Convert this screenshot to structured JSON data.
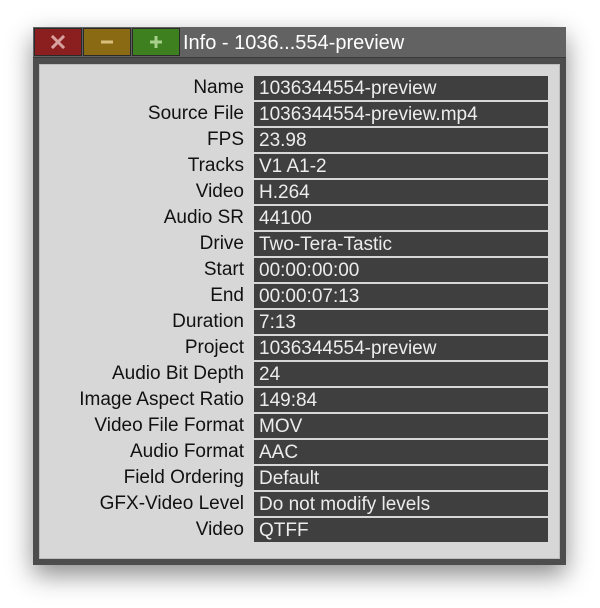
{
  "window": {
    "title": "Info - 1036...554-preview",
    "buttons": {
      "close_icon": "close-x-icon",
      "minimize_icon": "minus-icon",
      "maximize_icon": "plus-icon",
      "close_color": "#8b1e1e",
      "minimize_color": "#8b6a14",
      "maximize_color": "#3e7f20"
    }
  },
  "fields": [
    {
      "label": "Name",
      "value": "1036344554-preview"
    },
    {
      "label": "Source File",
      "value": "1036344554-preview.mp4"
    },
    {
      "label": "FPS",
      "value": "23.98"
    },
    {
      "label": "Tracks",
      "value": "V1 A1-2"
    },
    {
      "label": "Video",
      "value": "H.264"
    },
    {
      "label": "Audio SR",
      "value": "44100"
    },
    {
      "label": "Drive",
      "value": "Two-Tera-Tastic"
    },
    {
      "label": "Start",
      "value": "00:00:00:00"
    },
    {
      "label": "End",
      "value": "00:00:07:13"
    },
    {
      "label": "Duration",
      "value": "7:13"
    },
    {
      "label": "Project",
      "value": "1036344554-preview"
    },
    {
      "label": "Audio Bit Depth",
      "value": "24"
    },
    {
      "label": "Image Aspect Ratio",
      "value": "149:84"
    },
    {
      "label": "Video File Format",
      "value": "MOV"
    },
    {
      "label": "Audio Format",
      "value": "AAC"
    },
    {
      "label": "Field Ordering",
      "value": "Default"
    },
    {
      "label": "GFX-Video Level",
      "value": "Do not modify levels"
    },
    {
      "label": "Video",
      "value": "QTFF"
    }
  ]
}
